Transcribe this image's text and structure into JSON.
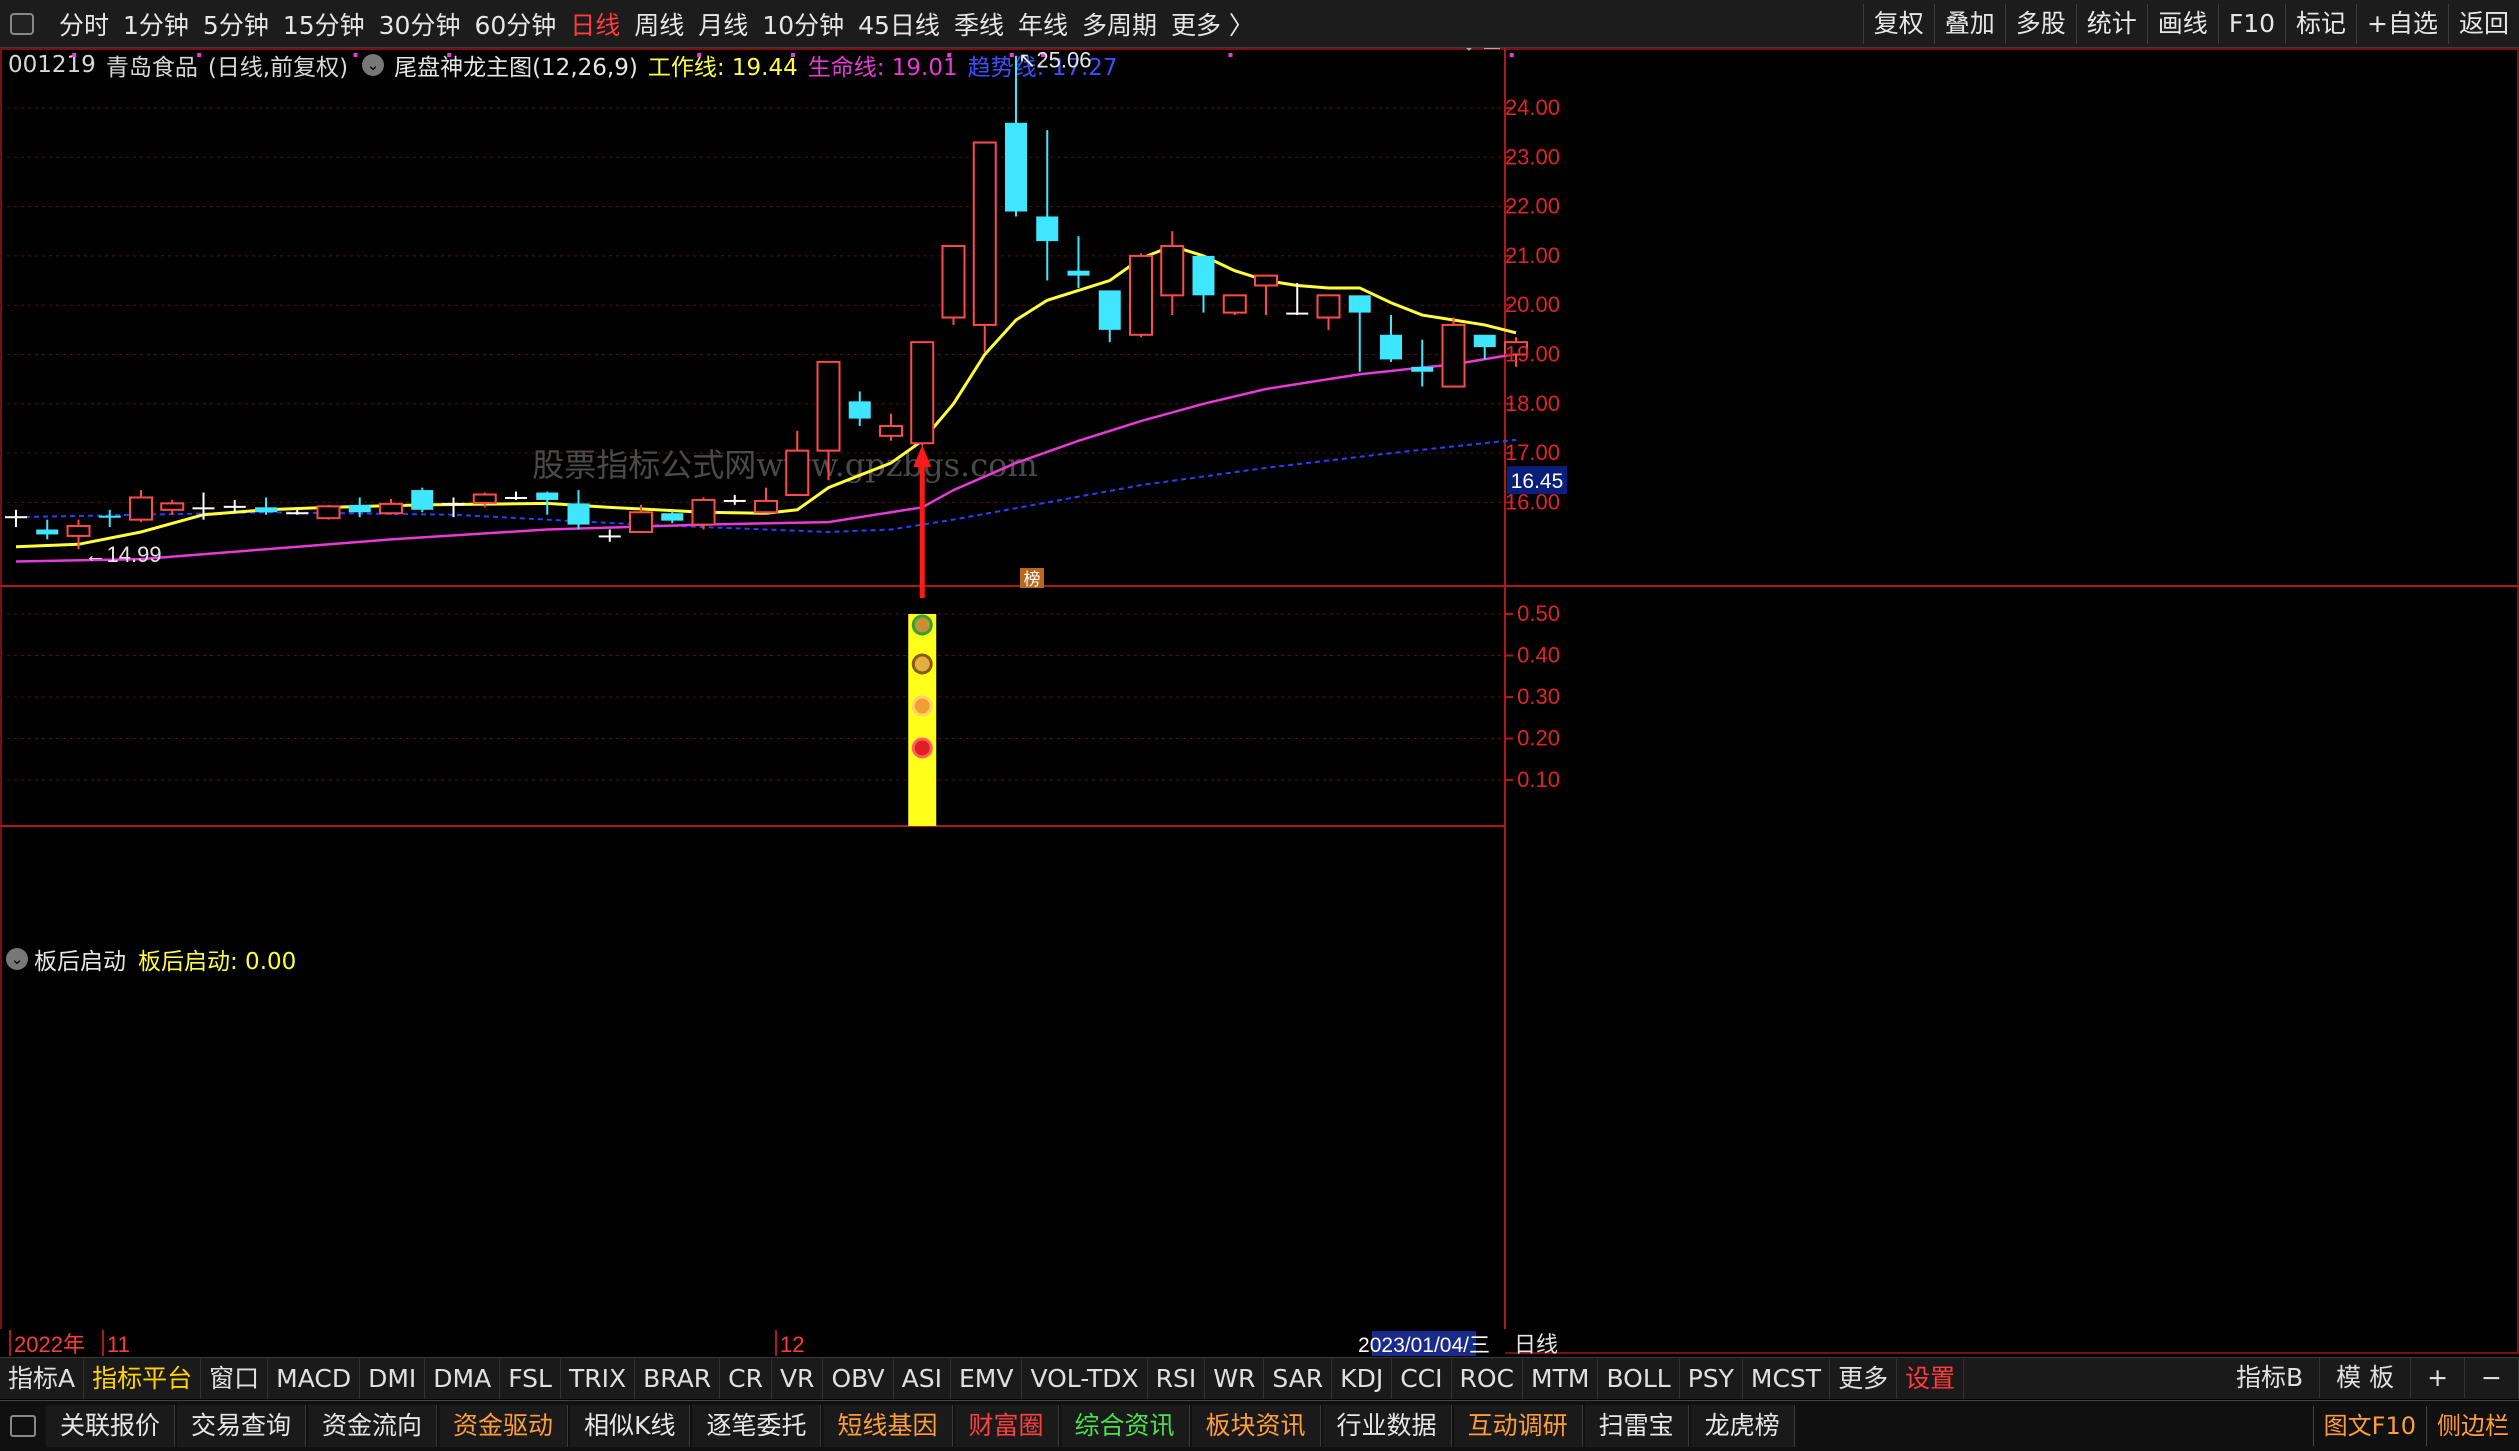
{
  "toolbar": {
    "periods": [
      {
        "label": "分时"
      },
      {
        "label": "1分钟"
      },
      {
        "label": "5分钟"
      },
      {
        "label": "15分钟"
      },
      {
        "label": "30分钟"
      },
      {
        "label": "60分钟"
      },
      {
        "label": "日线",
        "active": true
      },
      {
        "label": "周线"
      },
      {
        "label": "月线"
      },
      {
        "label": "10分钟"
      },
      {
        "label": "45日线"
      },
      {
        "label": "季线"
      },
      {
        "label": "年线"
      },
      {
        "label": "多周期"
      },
      {
        "label": "更多 〉"
      }
    ],
    "tools": [
      "复权",
      "叠加",
      "多股",
      "统计",
      "画线",
      "F10",
      "标记",
      "+自选",
      "返回"
    ]
  },
  "stock": {
    "code": "001219",
    "name": "青岛食品",
    "mode": "(日线,前复权)",
    "indicator": "尾盘神龙主图(12,26,9)",
    "work_line": "工作线: 19.44",
    "life_line": "生命线: 19.01",
    "trend_line": "趋势线: 17.27"
  },
  "sub_indicator": {
    "name": "板后启动",
    "value_text": "板后启动: 0.00"
  },
  "chart_data": {
    "type": "candlestick",
    "price_axis": {
      "ticks": [
        16.0,
        17.0,
        18.0,
        19.0,
        20.0,
        21.0,
        22.0,
        23.0,
        24.0
      ],
      "ylim": [
        14.4,
        25.6
      ]
    },
    "current_price_label": "16.45",
    "max_label": "25.06",
    "min_label": "14.99",
    "candles": [
      [
        15.72,
        15.72,
        15.85,
        15.5
      ],
      [
        15.45,
        15.35,
        15.65,
        15.25
      ],
      [
        15.32,
        15.52,
        15.65,
        15.05
      ],
      [
        15.73,
        15.7,
        15.85,
        15.5
      ],
      [
        15.65,
        16.1,
        16.25,
        15.6
      ],
      [
        15.85,
        15.98,
        16.05,
        15.75
      ],
      [
        15.9,
        15.9,
        16.2,
        15.65
      ],
      [
        15.93,
        15.93,
        16.05,
        15.8
      ],
      [
        15.9,
        15.8,
        16.1,
        15.75
      ],
      [
        15.8,
        15.8,
        15.85,
        15.75
      ],
      [
        15.68,
        15.92,
        15.95,
        15.65
      ],
      [
        15.95,
        15.8,
        16.1,
        15.7
      ],
      [
        15.78,
        15.97,
        16.07,
        15.75
      ],
      [
        16.25,
        15.85,
        16.3,
        15.8
      ],
      [
        15.99,
        15.99,
        16.1,
        15.7
      ],
      [
        15.99,
        16.16,
        16.2,
        15.9
      ],
      [
        16.11,
        16.11,
        16.22,
        16.05
      ],
      [
        16.2,
        16.05,
        16.22,
        15.75
      ],
      [
        15.98,
        15.55,
        16.25,
        15.45
      ],
      [
        15.33,
        15.33,
        15.45,
        15.2
      ],
      [
        15.4,
        15.8,
        15.95,
        15.4
      ],
      [
        15.78,
        15.63,
        15.82,
        15.58
      ],
      [
        15.55,
        16.05,
        16.1,
        15.45
      ],
      [
        16.05,
        16.05,
        16.15,
        15.95
      ],
      [
        15.8,
        16.03,
        16.3,
        15.78
      ],
      [
        16.15,
        17.05,
        17.45,
        16.15
      ],
      [
        17.05,
        18.85,
        18.85,
        16.45
      ],
      [
        18.05,
        17.7,
        18.25,
        17.55
      ],
      [
        17.35,
        17.55,
        17.8,
        17.25
      ],
      [
        17.2,
        19.25,
        19.25,
        17.15
      ],
      [
        19.75,
        21.2,
        21.2,
        19.6
      ],
      [
        19.6,
        23.3,
        23.3,
        19.05
      ],
      [
        23.7,
        21.9,
        25.06,
        21.8
      ],
      [
        21.8,
        21.3,
        23.55,
        20.5
      ],
      [
        20.7,
        20.6,
        21.4,
        20.35
      ],
      [
        20.3,
        19.5,
        20.3,
        19.25
      ],
      [
        19.4,
        21.0,
        21.05,
        19.35
      ],
      [
        20.2,
        21.2,
        21.5,
        19.8
      ],
      [
        21.0,
        20.2,
        21.0,
        19.85
      ],
      [
        19.85,
        20.2,
        20.2,
        19.8
      ],
      [
        20.4,
        20.6,
        20.6,
        19.8
      ],
      [
        19.85,
        19.85,
        20.45,
        19.8
      ],
      [
        19.75,
        20.2,
        20.2,
        19.5
      ],
      [
        20.2,
        19.85,
        20.2,
        18.65
      ],
      [
        19.4,
        18.9,
        19.8,
        18.85
      ],
      [
        18.75,
        18.65,
        19.3,
        18.35
      ],
      [
        18.35,
        19.6,
        19.75,
        18.35
      ],
      [
        19.4,
        19.15,
        19.4,
        18.9
      ],
      [
        19.0,
        19.25,
        19.35,
        18.75
      ]
    ],
    "series": [
      {
        "name": "工作线",
        "color": "#ffff3a"
      },
      {
        "name": "生命线",
        "color": "#e83ad6"
      },
      {
        "name": "趋势线",
        "color": "#2a3fff"
      }
    ],
    "lines": {
      "work": [
        [
          0,
          15.1
        ],
        [
          2,
          15.15
        ],
        [
          4,
          15.4
        ],
        [
          6,
          15.75
        ],
        [
          8,
          15.85
        ],
        [
          10,
          15.9
        ],
        [
          13,
          15.95
        ],
        [
          17,
          15.98
        ],
        [
          19,
          15.9
        ],
        [
          22,
          15.8
        ],
        [
          24,
          15.78
        ],
        [
          25,
          15.85
        ],
        [
          26,
          16.3
        ],
        [
          28,
          16.8
        ],
        [
          29,
          17.25
        ],
        [
          30,
          18.0
        ],
        [
          31,
          19.0
        ],
        [
          32,
          19.7
        ],
        [
          33,
          20.1
        ],
        [
          34,
          20.3
        ],
        [
          35,
          20.5
        ],
        [
          36,
          20.95
        ],
        [
          37,
          21.2
        ],
        [
          38,
          21.0
        ],
        [
          39,
          20.7
        ],
        [
          40,
          20.5
        ],
        [
          41,
          20.4
        ],
        [
          42,
          20.35
        ],
        [
          43,
          20.35
        ],
        [
          44,
          20.05
        ],
        [
          45,
          19.8
        ],
        [
          46,
          19.7
        ],
        [
          47,
          19.6
        ],
        [
          48,
          19.44
        ]
      ],
      "life": [
        [
          0,
          14.8
        ],
        [
          4,
          14.85
        ],
        [
          8,
          15.05
        ],
        [
          12,
          15.25
        ],
        [
          17,
          15.45
        ],
        [
          22,
          15.55
        ],
        [
          26,
          15.6
        ],
        [
          28,
          15.8
        ],
        [
          29,
          15.9
        ],
        [
          30,
          16.25
        ],
        [
          32,
          16.8
        ],
        [
          34,
          17.25
        ],
        [
          36,
          17.65
        ],
        [
          38,
          18.0
        ],
        [
          40,
          18.3
        ],
        [
          43,
          18.6
        ],
        [
          46,
          18.8
        ],
        [
          48,
          19.01
        ]
      ],
      "trend": [
        [
          0,
          15.7
        ],
        [
          8,
          15.8
        ],
        [
          14,
          15.75
        ],
        [
          20,
          15.55
        ],
        [
          26,
          15.4
        ],
        [
          28,
          15.45
        ],
        [
          30,
          15.65
        ],
        [
          33,
          16.0
        ],
        [
          36,
          16.35
        ],
        [
          40,
          16.7
        ],
        [
          44,
          17.0
        ],
        [
          48,
          17.27
        ]
      ]
    },
    "marker_day": 29,
    "sub_axis": {
      "ticks": [
        0.1,
        0.2,
        0.3,
        0.4,
        0.5
      ]
    },
    "x_labels": [
      {
        "label": "2022年",
        "color": "#ff3b3b"
      },
      {
        "label": "11",
        "color": "#ff3b3b"
      },
      {
        "label": "12",
        "color": "#ff3b3b"
      }
    ],
    "cursor_date": "2023/01/04/三",
    "period_label": "日线",
    "rank_badge": "榜",
    "watermark": "股票指标公式网www.gpzbgs.com"
  },
  "indicator_tabs": [
    {
      "label": "指标A"
    },
    {
      "label": "指标平台",
      "hl": true
    },
    {
      "label": "窗口"
    },
    {
      "label": "MACD"
    },
    {
      "label": "DMI"
    },
    {
      "label": "DMA"
    },
    {
      "label": "FSL"
    },
    {
      "label": "TRIX"
    },
    {
      "label": "BRAR"
    },
    {
      "label": "CR"
    },
    {
      "label": "VR"
    },
    {
      "label": "OBV"
    },
    {
      "label": "ASI"
    },
    {
      "label": "EMV"
    },
    {
      "label": "VOL-TDX"
    },
    {
      "label": "RSI"
    },
    {
      "label": "WR"
    },
    {
      "label": "SAR"
    },
    {
      "label": "KDJ"
    },
    {
      "label": "CCI"
    },
    {
      "label": "ROC"
    },
    {
      "label": "MTM"
    },
    {
      "label": "BOLL"
    },
    {
      "label": "PSY"
    },
    {
      "label": "MCST"
    },
    {
      "label": "更多"
    },
    {
      "label": "设置",
      "red": true
    }
  ],
  "indicator_tabs_right": [
    "指标B",
    "模 板",
    "+",
    "−"
  ],
  "func_buttons": [
    {
      "label": "关联报价",
      "c": ""
    },
    {
      "label": "交易查询",
      "c": ""
    },
    {
      "label": "资金流向",
      "c": ""
    },
    {
      "label": "资金驱动",
      "c": "orange"
    },
    {
      "label": "相似K线",
      "c": ""
    },
    {
      "label": "逐笔委托",
      "c": ""
    },
    {
      "label": "短线基因",
      "c": "orange"
    },
    {
      "label": "财富圈",
      "c": "red"
    },
    {
      "label": "综合资讯",
      "c": "green"
    },
    {
      "label": "板块资讯",
      "c": "orange"
    },
    {
      "label": "行业数据",
      "c": ""
    },
    {
      "label": "互动调研",
      "c": "orange"
    },
    {
      "label": "扫雷宝",
      "c": ""
    },
    {
      "label": "龙虎榜",
      "c": ""
    }
  ],
  "func_right": [
    "图文F10",
    "侧边栏"
  ]
}
